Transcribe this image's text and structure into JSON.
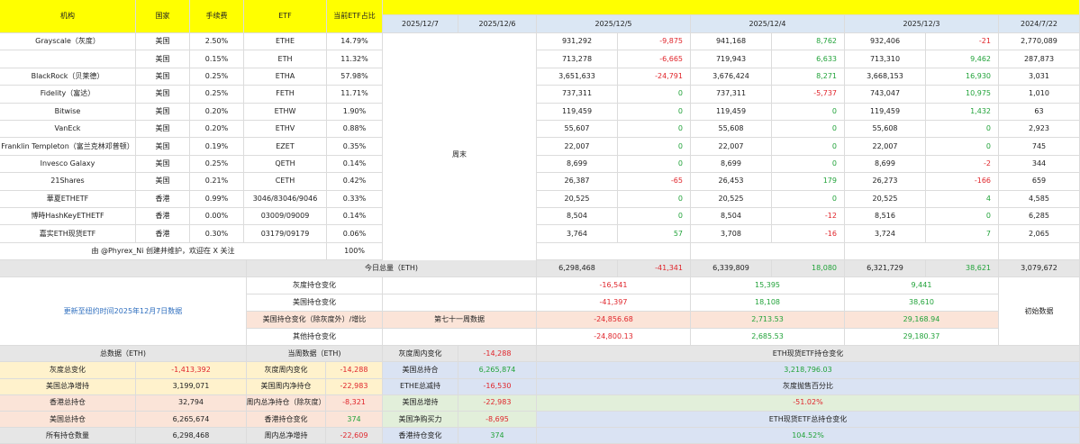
{
  "header": {
    "institution": "机构",
    "country": "国家",
    "fee": "手续费",
    "etf": "ETF",
    "share": "当前ETF占比",
    "dates": [
      "2025/12/7",
      "2025/12/6",
      "2025/12/5",
      "2025/12/4",
      "2025/12/3",
      "2024/7/22"
    ]
  },
  "rows": [
    {
      "name": "Grayscale（灰度）",
      "country": "美国",
      "fee": "2.50%",
      "etf": "ETHE",
      "share": "14.79%",
      "d5": "931,292",
      "c5": "-9,875",
      "d4": "941,168",
      "c4": "8,762",
      "d3": "932,406",
      "c3": "-21",
      "init": "2,770,089"
    },
    {
      "name": "",
      "country": "美国",
      "fee": "0.15%",
      "etf": "ETH",
      "share": "11.32%",
      "d5": "713,278",
      "c5": "-6,665",
      "d4": "719,943",
      "c4": "6,633",
      "d3": "713,310",
      "c3": "9,462",
      "init": "287,873"
    },
    {
      "name": "BlackRock（贝莱德）",
      "country": "美国",
      "fee": "0.25%",
      "etf": "ETHA",
      "share": "57.98%",
      "d5": "3,651,633",
      "c5": "-24,791",
      "d4": "3,676,424",
      "c4": "8,271",
      "d3": "3,668,153",
      "c3": "16,930",
      "init": "3,031"
    },
    {
      "name": "Fidelity（富达）",
      "country": "美国",
      "fee": "0.25%",
      "etf": "FETH",
      "share": "11.71%",
      "d5": "737,311",
      "c5": "0",
      "d4": "737,311",
      "c4": "-5,737",
      "d3": "743,047",
      "c3": "10,975",
      "init": "1,010"
    },
    {
      "name": "Bitwise",
      "country": "美国",
      "fee": "0.20%",
      "etf": "ETHW",
      "share": "1.90%",
      "d5": "119,459",
      "c5": "0",
      "d4": "119,459",
      "c4": "0",
      "d3": "119,459",
      "c3": "1,432",
      "init": "63"
    },
    {
      "name": "VanEck",
      "country": "美国",
      "fee": "0.20%",
      "etf": "ETHV",
      "share": "0.88%",
      "d5": "55,607",
      "c5": "0",
      "d4": "55,608",
      "c4": "0",
      "d3": "55,608",
      "c3": "0",
      "init": "2,923"
    },
    {
      "name": "Franklin Templeton（富兰克林邓普顿）",
      "country": "美国",
      "fee": "0.19%",
      "etf": "EZET",
      "share": "0.35%",
      "d5": "22,007",
      "c5": "0",
      "d4": "22,007",
      "c4": "0",
      "d3": "22,007",
      "c3": "0",
      "init": "745"
    },
    {
      "name": "Invesco Galaxy",
      "country": "美国",
      "fee": "0.25%",
      "etf": "QETH",
      "share": "0.14%",
      "d5": "8,699",
      "c5": "0",
      "d4": "8,699",
      "c4": "0",
      "d3": "8,699",
      "c3": "-2",
      "init": "344"
    },
    {
      "name": "21Shares",
      "country": "美国",
      "fee": "0.21%",
      "etf": "CETH",
      "share": "0.42%",
      "d5": "26,387",
      "c5": "-65",
      "d4": "26,453",
      "c4": "179",
      "d3": "26,273",
      "c3": "-166",
      "init": "659"
    },
    {
      "name": "華夏ETHETF",
      "country": "香港",
      "fee": "0.99%",
      "etf": "3046/83046/9046",
      "share": "0.33%",
      "d5": "20,525",
      "c5": "0",
      "d4": "20,525",
      "c4": "0",
      "d3": "20,525",
      "c3": "4",
      "init": "4,585"
    },
    {
      "name": "博時HashKeyETHETF",
      "country": "香港",
      "fee": "0.00%",
      "etf": "03009/09009",
      "share": "0.14%",
      "d5": "8,504",
      "c5": "0",
      "d4": "8,504",
      "c4": "-12",
      "d3": "8,516",
      "c3": "0",
      "init": "6,285"
    },
    {
      "name": "嘉实ETH现货ETF",
      "country": "香港",
      "fee": "0.30%",
      "etf": "03179/09179",
      "share": "0.06%",
      "d5": "3,764",
      "c5": "57",
      "d4": "3,708",
      "c4": "-16",
      "d3": "3,724",
      "c3": "7",
      "init": "2,065"
    }
  ],
  "weekend": "周末",
  "credit": "由 @Phyrex_Ni 创建并维护，欢迎在 X 关注",
  "credit_pct": "100%",
  "total": {
    "label": "今日总量（ETH)",
    "d5": "6,298,468",
    "c5": "-41,341",
    "d4": "6,339,809",
    "c4": "18,080",
    "d3": "6,321,729",
    "c3": "38,621",
    "init": "3,079,672"
  },
  "updated": "更新至纽约时间2025年12月7日数据",
  "changes": [
    {
      "label": "灰度持仓变化",
      "v5": "-16,541",
      "v4": "15,395",
      "v3": "9,441"
    },
    {
      "label": "美国持仓变化",
      "v5": "-41,397",
      "v4": "18,108",
      "v3": "38,610"
    },
    {
      "label": "美国持仓变化（除灰度外）/增比",
      "week": "第七十一周数据",
      "v5": "-24,856.68",
      "v4": "2,713.53",
      "v3": "29,168.94"
    },
    {
      "label": "其他持仓变化",
      "v5": "-24,800.13",
      "v4": "2,685.53",
      "v3": "29,180.37"
    }
  ],
  "initial_label": "初始数据",
  "summary": {
    "h1": "总数据（ETH)",
    "h2": "当周数据（ETH)",
    "left": [
      {
        "k": "灰度总变化",
        "v": "-1,413,392"
      },
      {
        "k": "美国总净增持",
        "v": "3,199,071"
      },
      {
        "k": "香港总持仓",
        "v": "32,794"
      },
      {
        "k": "美国总持仓",
        "v": "6,265,674"
      },
      {
        "k": "所有持仓数量",
        "v": "6,298,468"
      }
    ],
    "mid": [
      {
        "k": "灰度周内变化",
        "v": "-14,288"
      },
      {
        "k": "美国周内净持仓",
        "v": "-22,983"
      },
      {
        "k": "周内总净持仓（除灰度）",
        "v": "-8,321"
      },
      {
        "k": "香港持仓变化",
        "v": "374"
      },
      {
        "k": "周内总净增持",
        "v": "-22,609"
      }
    ],
    "right": [
      {
        "k": "灰度周内变化",
        "v": "-14,288"
      },
      {
        "k": "美国总持合",
        "v": "6,265,874"
      },
      {
        "k": "ETHE总减持",
        "v": "-16,530"
      },
      {
        "k": "美国总增持",
        "v": "-22,983"
      },
      {
        "k": "美国净购买力",
        "v": "-8,695"
      },
      {
        "k": "香港持仓变化",
        "v": "374"
      }
    ],
    "far": [
      {
        "k": "ETH现货ETF持仓变化"
      },
      {
        "v": "3,218,796.03"
      },
      {
        "k": "灰度抛售百分比"
      },
      {
        "v": "-51.02%"
      },
      {
        "k": "ETH现货ETF总持仓变化"
      },
      {
        "v": "104.52%"
      }
    ]
  }
}
